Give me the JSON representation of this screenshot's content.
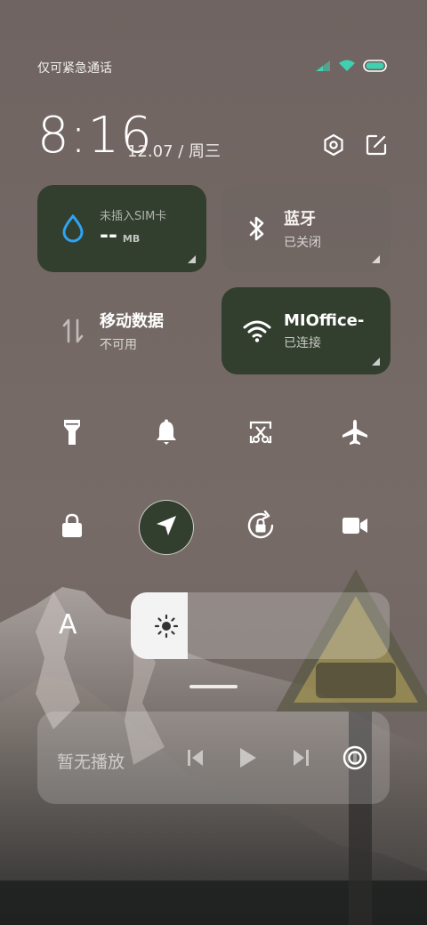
{
  "status": {
    "carrier_text": "仅可紧急通话",
    "signal_icon": "signal-icon",
    "wifi_icon": "wifi-icon",
    "battery_icon": "battery-icon",
    "accent": "#3fd0b0"
  },
  "header": {
    "time": "8:16",
    "date": "12.07 / 周三",
    "settings_icon": "gear-icon",
    "edit_icon": "edit-icon"
  },
  "tiles": {
    "data_usage": {
      "label": "未插入SIM卡",
      "value": "--",
      "unit": "MB",
      "state": "on"
    },
    "bluetooth": {
      "label": "蓝牙",
      "status": "已关闭",
      "state": "off"
    },
    "mobile_data": {
      "label": "移动数据",
      "status": "不可用",
      "state": "off"
    },
    "wifi": {
      "label": "MIOffice-",
      "status": "已连接",
      "state": "on"
    }
  },
  "toggles_row1": [
    {
      "name": "flashlight",
      "icon": "flashlight-icon"
    },
    {
      "name": "ring",
      "icon": "bell-icon"
    },
    {
      "name": "screenshot",
      "icon": "scissors-icon"
    },
    {
      "name": "airplane",
      "icon": "airplane-icon"
    }
  ],
  "toggles_row2": [
    {
      "name": "lock",
      "icon": "lock-icon"
    },
    {
      "name": "location",
      "icon": "location-icon",
      "active": true
    },
    {
      "name": "rotation-lock",
      "icon": "rotation-lock-icon"
    },
    {
      "name": "screen-record",
      "icon": "video-camera-icon"
    }
  ],
  "brightness": {
    "font_label": "A",
    "level": 0.22,
    "icon": "sun-icon"
  },
  "media": {
    "label": "暂无播放",
    "prev_icon": "previous-icon",
    "play_icon": "play-icon",
    "next_icon": "next-icon",
    "output_icon": "cast-icon"
  },
  "colors": {
    "active_tile": "#323e2e",
    "inactive_tile": "#6e6461"
  }
}
